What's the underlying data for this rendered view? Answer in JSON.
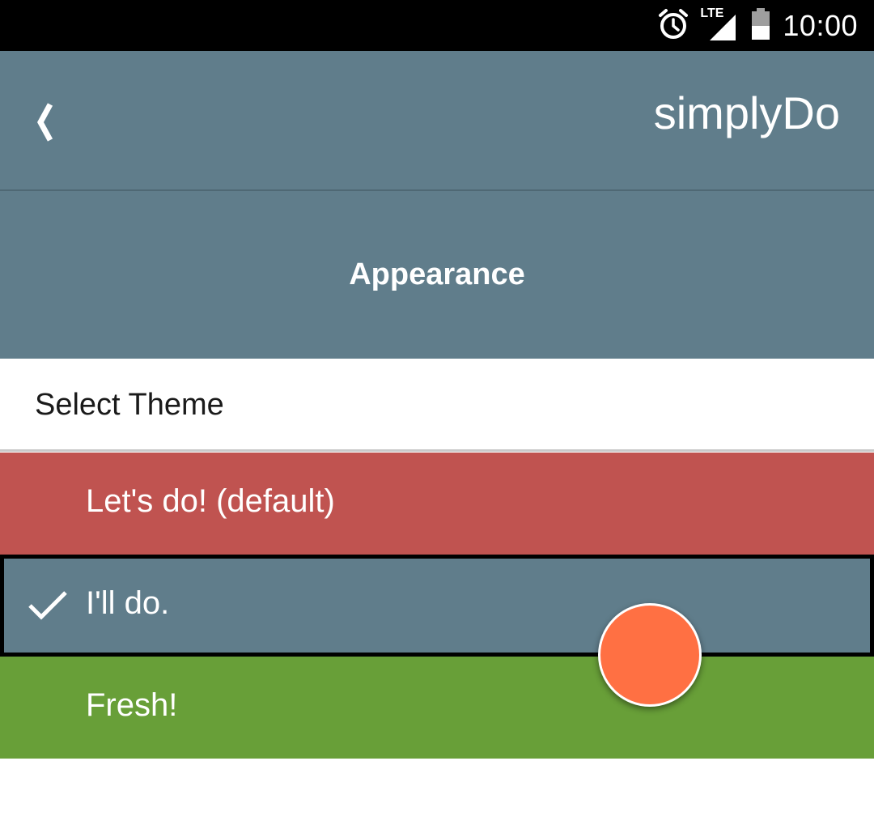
{
  "status_bar": {
    "time": "10:00",
    "network_label": "LTE",
    "icons": [
      "alarm-icon",
      "signal-icon",
      "battery-icon"
    ]
  },
  "app_bar": {
    "title": "simplyDo",
    "back_icon": "chevron-left-icon"
  },
  "section": {
    "title": "Appearance"
  },
  "preference": {
    "label": "Select Theme"
  },
  "themes": [
    {
      "label": "Let's do! (default)",
      "color": "#c05350",
      "selected": false
    },
    {
      "label": "I'll do.",
      "color": "#607d8b",
      "selected": true
    },
    {
      "label": "Fresh!",
      "color": "#689f38",
      "selected": false
    }
  ],
  "fab": {
    "color": "#ff7043"
  }
}
